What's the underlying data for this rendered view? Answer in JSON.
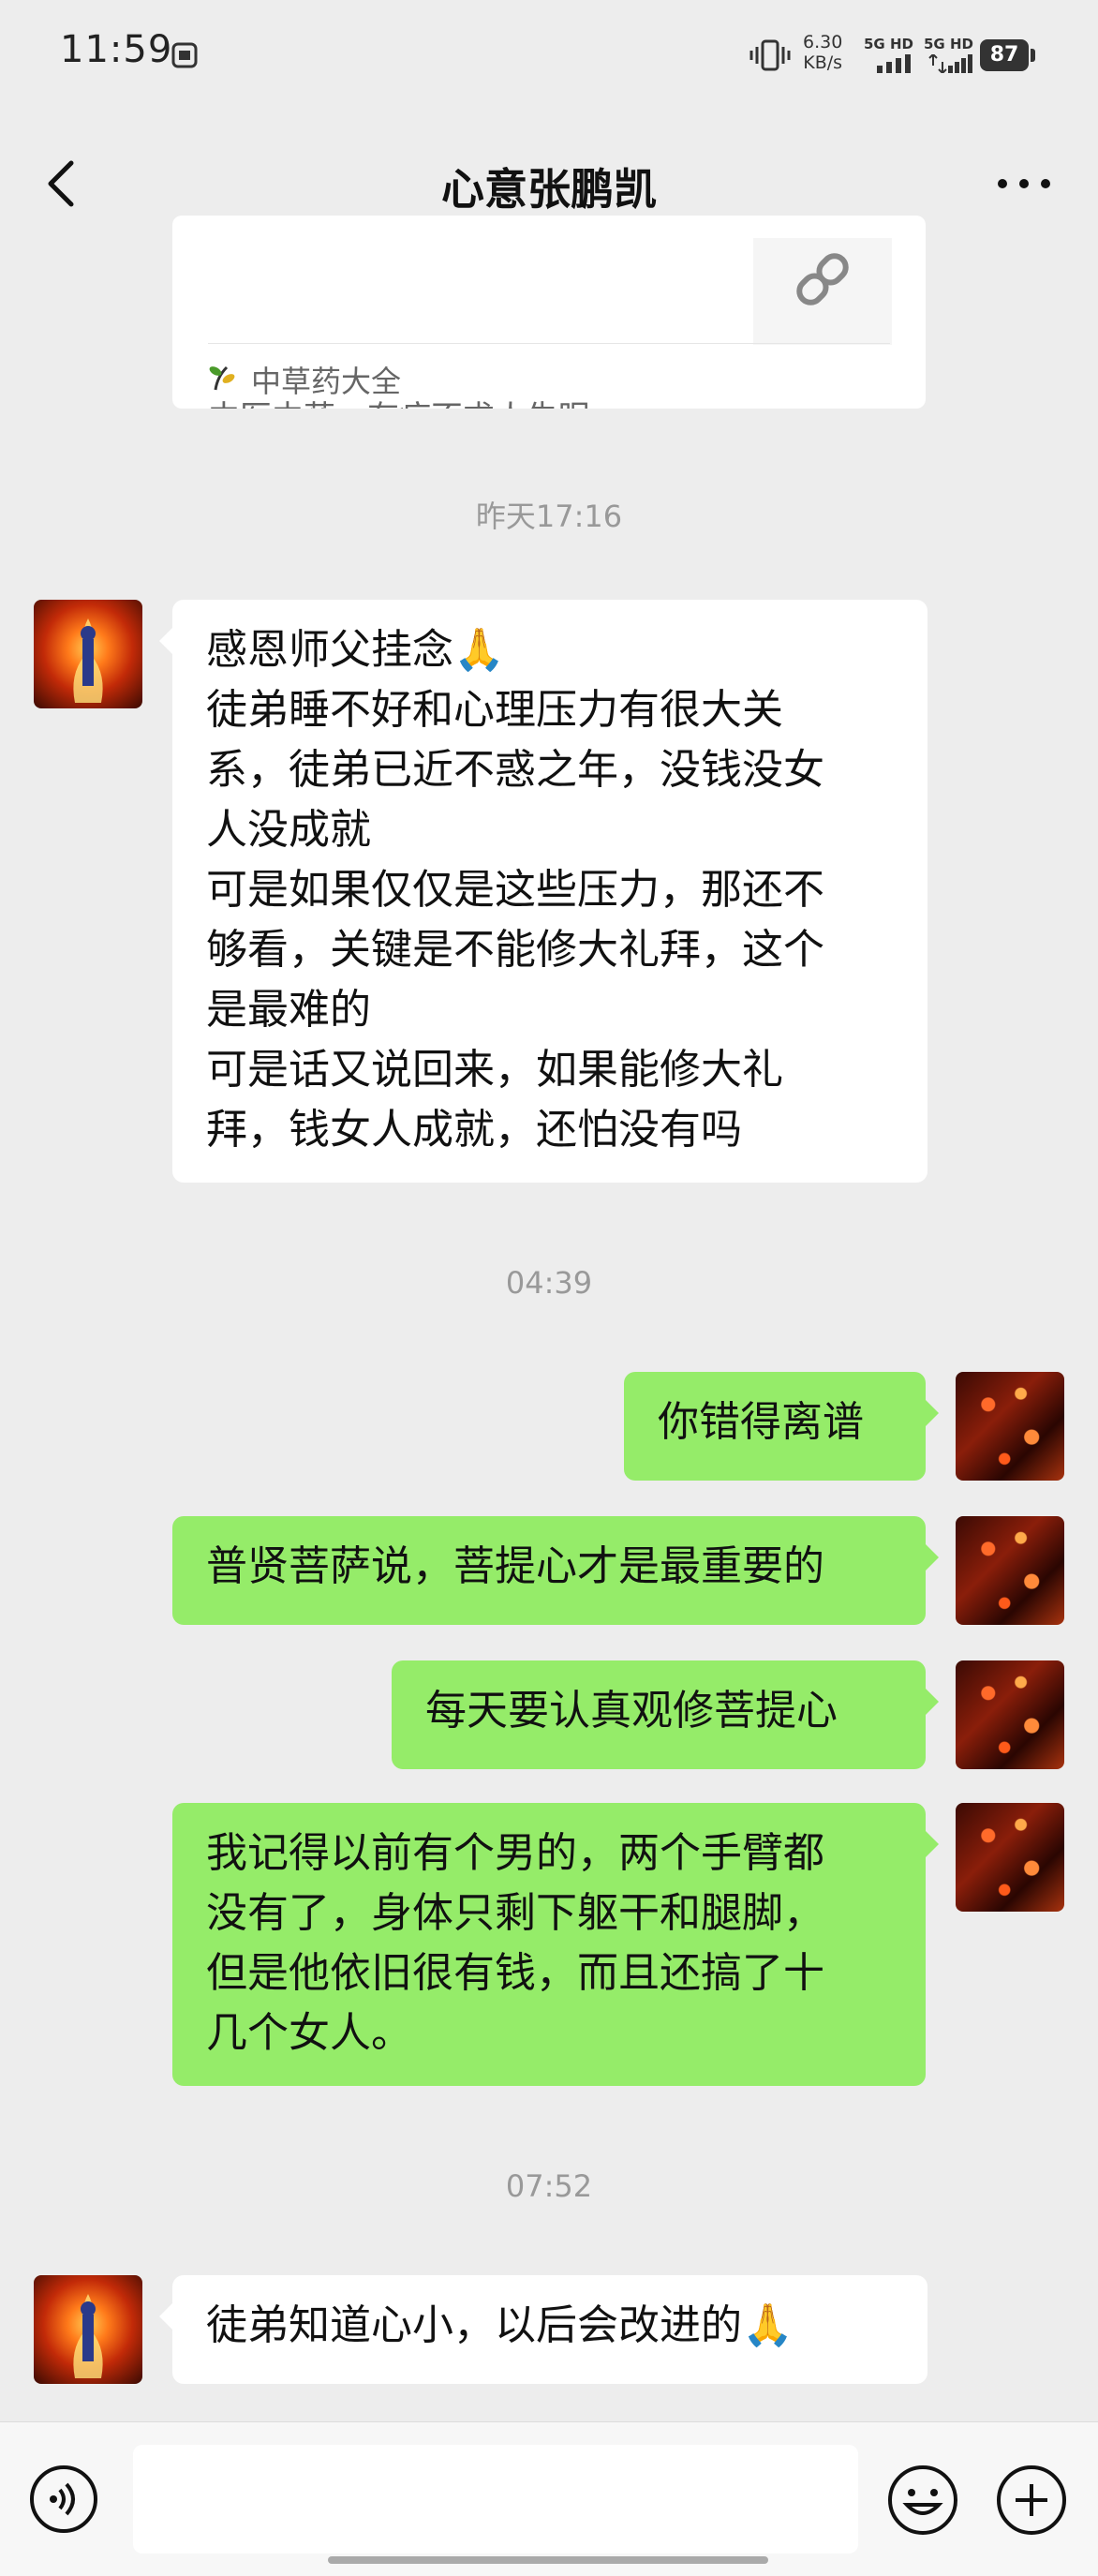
{
  "status_bar": {
    "time": "11:59",
    "net_speed_value": "6.30",
    "net_speed_unit": "KB/s",
    "signal1_label": "5G HD",
    "signal2_label": "5G HD",
    "battery": "87"
  },
  "header": {
    "title": "心意张鹏凯"
  },
  "link_card": {
    "desc_line1": "… … …",
    "desc_line2": "中医中药、有病不求人失眠…",
    "source": "中草药大全"
  },
  "messages": [
    {
      "type": "timestamp",
      "text": "昨天17:16"
    },
    {
      "type": "incoming",
      "lines": [
        "感恩师父挂念🙏",
        "徒弟睡不好和心理压力有很大关",
        "系，徒弟已近不惑之年，没钱没女",
        "人没成就",
        "可是如果仅仅是这些压力，那还不",
        "够看，关键是不能修大礼拜，这个",
        "是最难的",
        "可是话又说回来，如果能修大礼",
        "拜，钱女人成就，还怕没有吗"
      ]
    },
    {
      "type": "timestamp",
      "text": "04:39"
    },
    {
      "type": "outgoing",
      "lines": [
        "你错得离谱"
      ]
    },
    {
      "type": "outgoing",
      "lines": [
        "普贤菩萨说，菩提心才是最重要的"
      ]
    },
    {
      "type": "outgoing",
      "lines": [
        "每天要认真观修菩提心"
      ]
    },
    {
      "type": "outgoing",
      "lines": [
        "我记得以前有个男的，两个手臂都",
        "没有了，身体只剩下躯干和腿脚，",
        "但是他依旧很有钱，而且还搞了十",
        "几个女人。"
      ]
    },
    {
      "type": "timestamp",
      "text": "07:52"
    },
    {
      "type": "incoming",
      "lines": [
        "徒弟知道心小，以后会改进的🙏"
      ]
    }
  ],
  "input_bar": {
    "placeholder": ""
  },
  "colors": {
    "background": "#ededed",
    "outgoing_bubble": "#95ec69",
    "incoming_bubble": "#ffffff"
  }
}
